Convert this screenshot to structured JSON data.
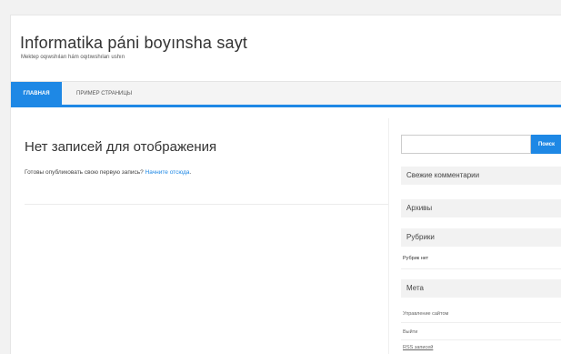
{
  "header": {
    "site_title": "Informatika páni boyınsha sayt",
    "tagline": "Mektep oqıwshıları hám oqıtıwshıları ushın"
  },
  "nav": {
    "items": [
      {
        "label": "ГЛАВНАЯ",
        "active": true
      },
      {
        "label": "ПРИМЕР СТРАНИЦЫ",
        "active": false
      }
    ]
  },
  "main": {
    "title": "Нет записей для отображения",
    "text": "Готовы опубликовать свою первую запись?",
    "link_text": "Начните отсюда",
    "text_end": "."
  },
  "sidebar": {
    "search": {
      "value": "",
      "placeholder": "",
      "button_label": "Поиск"
    },
    "widgets": {
      "recent_comments": "Свежие комментарии",
      "archives": "Архивы",
      "categories": "Рубрики",
      "categories_empty": "Рубрик нет",
      "meta": "Мета",
      "meta_links": [
        "Управление сайтом",
        "Выйти",
        "RSS записей"
      ]
    }
  },
  "colors": {
    "accent": "#1e88e5",
    "widget_bg": "#f2f2f2"
  }
}
